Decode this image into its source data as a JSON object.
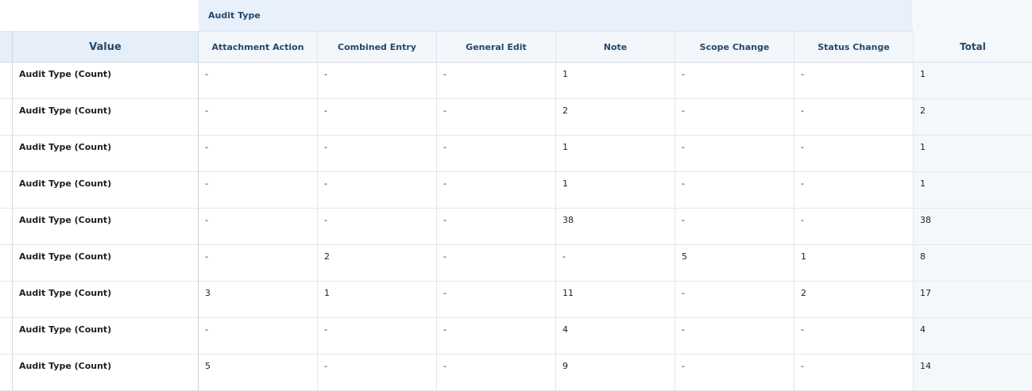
{
  "table": {
    "group_header": "Audit Type",
    "value_header": "Value",
    "columns": [
      "Attachment Action",
      "Combined Entry",
      "General Edit",
      "Note",
      "Scope Change",
      "Status Change"
    ],
    "total_header": "Total",
    "rows": [
      {
        "label": "Audit Type (Count)",
        "cells": [
          "-",
          "-",
          "-",
          "1",
          "-",
          "-"
        ],
        "total": "1"
      },
      {
        "label": "Audit Type (Count)",
        "cells": [
          "-",
          "-",
          "-",
          "2",
          "-",
          "-"
        ],
        "total": "2"
      },
      {
        "label": "Audit Type (Count)",
        "cells": [
          "-",
          "-",
          "-",
          "1",
          "-",
          "-"
        ],
        "total": "1"
      },
      {
        "label": "Audit Type (Count)",
        "cells": [
          "-",
          "-",
          "-",
          "1",
          "-",
          "-"
        ],
        "total": "1"
      },
      {
        "label": "Audit Type (Count)",
        "cells": [
          "-",
          "-",
          "-",
          "38",
          "-",
          "-"
        ],
        "total": "38"
      },
      {
        "label": "Audit Type (Count)",
        "cells": [
          "-",
          "2",
          "-",
          "-",
          "5",
          "1"
        ],
        "total": "8"
      },
      {
        "label": "Audit Type (Count)",
        "cells": [
          "3",
          "1",
          "-",
          "11",
          "-",
          "2"
        ],
        "total": "17"
      },
      {
        "label": "Audit Type (Count)",
        "cells": [
          "-",
          "-",
          "-",
          "4",
          "-",
          "-"
        ],
        "total": "4"
      },
      {
        "label": "Audit Type (Count)",
        "cells": [
          "5",
          "-",
          "-",
          "9",
          "-",
          "-"
        ],
        "total": "14"
      }
    ]
  },
  "colors": {
    "group_header_bg": "#e7f0fb",
    "header_text": "#27476a",
    "total_bg": "#f5f8fb"
  }
}
